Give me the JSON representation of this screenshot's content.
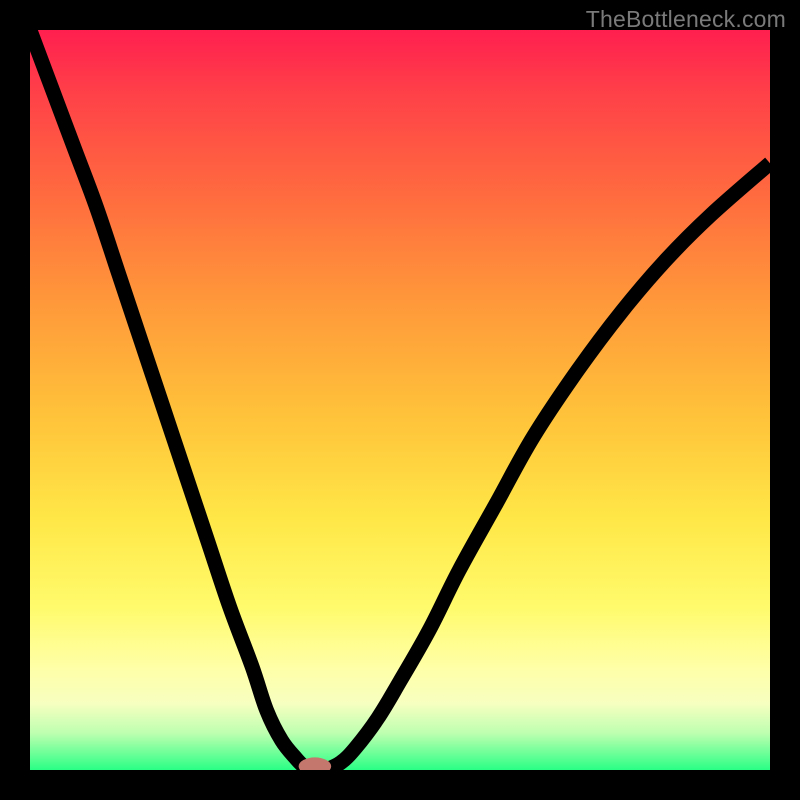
{
  "watermark": "TheBottleneck.com",
  "chart_data": {
    "type": "line",
    "title": "",
    "xlabel": "",
    "ylabel": "",
    "xlim": [
      0,
      100
    ],
    "ylim": [
      0,
      100
    ],
    "background_gradient_stops": [
      {
        "pct": 0,
        "color": "#ff1f4f"
      },
      {
        "pct": 9,
        "color": "#ff4248"
      },
      {
        "pct": 22,
        "color": "#ff6a3f"
      },
      {
        "pct": 36,
        "color": "#ff963a"
      },
      {
        "pct": 52,
        "color": "#ffc23a"
      },
      {
        "pct": 66,
        "color": "#ffe747"
      },
      {
        "pct": 78,
        "color": "#fffb6c"
      },
      {
        "pct": 86,
        "color": "#ffffa6"
      },
      {
        "pct": 91,
        "color": "#f7ffc0"
      },
      {
        "pct": 95,
        "color": "#beffb0"
      },
      {
        "pct": 100,
        "color": "#2aff85"
      }
    ],
    "series": [
      {
        "name": "left-branch",
        "x": [
          0,
          3,
          6,
          9,
          12,
          15,
          18,
          21,
          24,
          27,
          30,
          32,
          34,
          36,
          37,
          38
        ],
        "y": [
          100,
          92,
          84,
          76,
          67,
          58,
          49,
          40,
          31,
          22,
          14,
          8,
          4,
          1.5,
          0.5,
          0
        ]
      },
      {
        "name": "right-branch",
        "x": [
          40,
          42,
          44,
          47,
          50,
          54,
          58,
          63,
          68,
          74,
          80,
          86,
          92,
          100
        ],
        "y": [
          0,
          1,
          3,
          7,
          12,
          19,
          27,
          36,
          45,
          54,
          62,
          69,
          75,
          82
        ]
      }
    ],
    "min_marker": {
      "x": 38.5,
      "y": 0.5,
      "rx": 2.2,
      "ry": 1.2,
      "color": "#c4776c"
    }
  }
}
